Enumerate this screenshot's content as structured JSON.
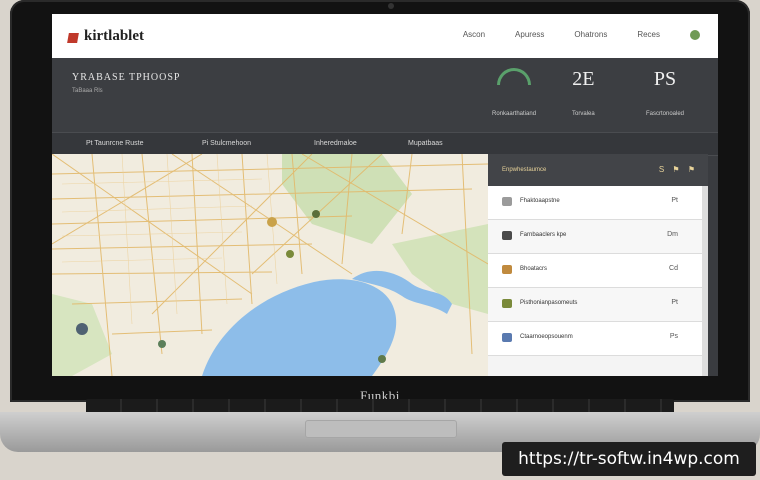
{
  "app": {
    "logo_text": "kirtlablet"
  },
  "nav": [
    "Ascon",
    "Apuress",
    "Ohatrons",
    "Reces"
  ],
  "banner": {
    "title": "YRABASE TPHOOSP",
    "subtitle": "TaBaaa Rls",
    "stats": [
      {
        "value": "",
        "label": "Ronkaarthatiand",
        "kind": "gauge"
      },
      {
        "value": "2E",
        "label": "Torvalea",
        "kind": "number"
      },
      {
        "value": "PS",
        "label": "Fascrtonoaled",
        "kind": "number"
      }
    ]
  },
  "tabs": [
    "Pt Taunrcne Ruste",
    "Pi Stulcmehoon",
    "Inheredmaloe",
    "Mupatbaas"
  ],
  "panel": {
    "header": "Enpwhestaumce",
    "header_icons": "S ⚑ ⚑",
    "rows": [
      {
        "icon_color": "#9b9b9b",
        "text": "Fhaktoaapstne",
        "meta": "Pt"
      },
      {
        "icon_color": "#4a4a4a",
        "text": "Farnbaaclers kpe",
        "meta": "Dm"
      },
      {
        "icon_color": "#c08a3e",
        "text": "Bhoatacrs",
        "meta": "Cd"
      },
      {
        "icon_color": "#7a8a3a",
        "text": "Pisthonianpasomeuts",
        "meta": "Pt"
      },
      {
        "icon_color": "#5a7ab0",
        "text": "Ctaarnoeopsouenm",
        "meta": "Ps"
      }
    ]
  },
  "laptop": {
    "brand": "Funkbi"
  },
  "watermark": "https://tr-softw.in4wp.com",
  "colors": {
    "accent_green": "#5aa06b",
    "water": "#7eb6e8",
    "road": "#e6c27a"
  }
}
